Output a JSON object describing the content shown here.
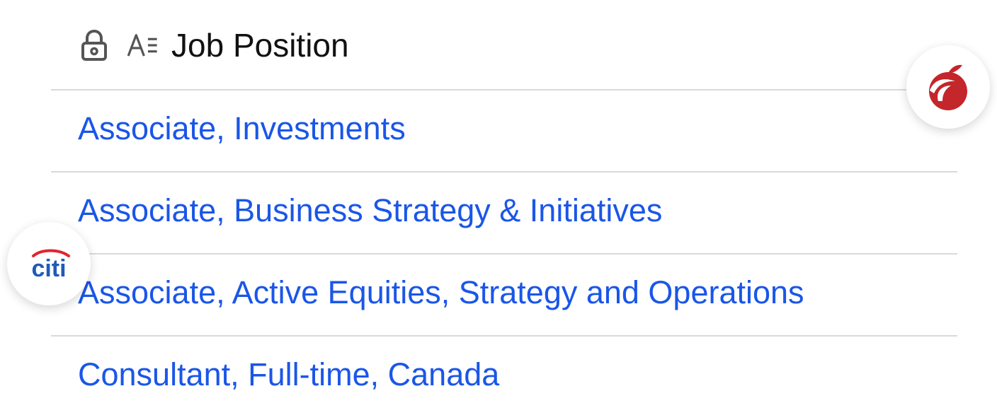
{
  "header": {
    "lock_icon": "lock-icon",
    "text_type_icon": "text-type-icon",
    "title": "Job Position"
  },
  "rows": [
    {
      "label": "Associate, Investments"
    },
    {
      "label": "Associate, Business Strategy & Initiatives"
    },
    {
      "label": "Associate, Active Equities, Strategy and Operations"
    },
    {
      "label": "Consultant, Full-time, Canada"
    }
  ],
  "avatars": {
    "top_right": {
      "icon": "red-apple-logo-icon"
    },
    "left": {
      "text": "citi",
      "icon": "citi-logo-icon"
    }
  },
  "colors": {
    "link": "#1a56e8",
    "divider": "#d9d9d9",
    "header_text": "#111111",
    "logo_red": "#c3262b",
    "citi_blue": "#1f5ab8",
    "citi_red": "#e3232c"
  }
}
